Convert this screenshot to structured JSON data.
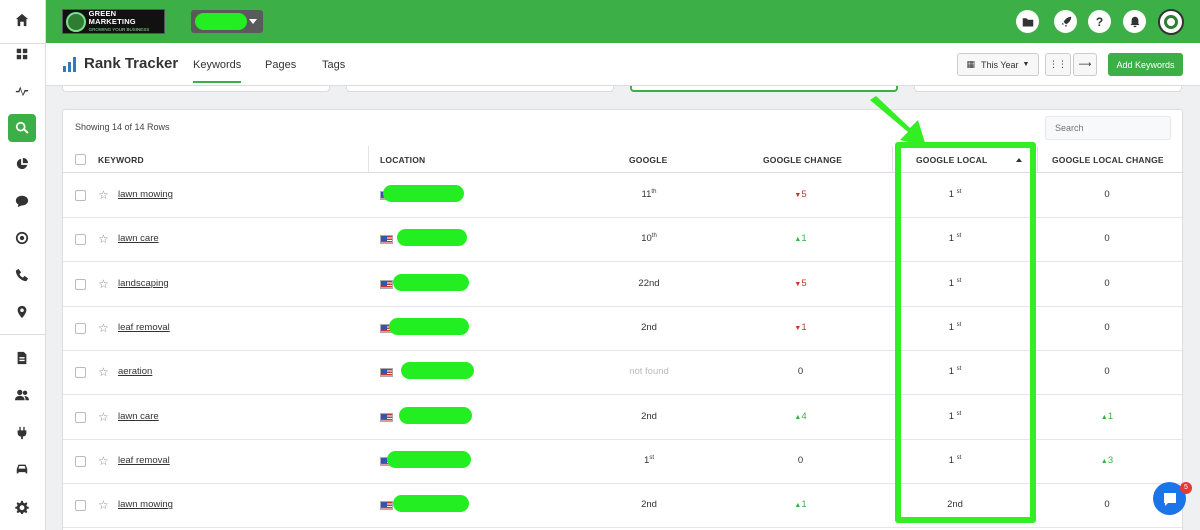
{
  "sidebar": {
    "icons": [
      "home-icon",
      "grid-icon",
      "activity-icon",
      "search-icon",
      "pie-chart-icon",
      "chat-icon",
      "target-icon",
      "phone-icon",
      "map-pin-icon",
      "document-icon",
      "users-icon",
      "plug-icon",
      "car-icon",
      "gear-icon"
    ],
    "active": "search-icon"
  },
  "topbar": {
    "logo_line1": "GREEN MARKETING",
    "logo_line2": "GROWING YOUR BUSINESS",
    "help_label": "?",
    "accent_color": "#3daf47"
  },
  "page": {
    "title": "Rank Tracker",
    "tabs": [
      {
        "label": "Keywords",
        "active": true
      },
      {
        "label": "Pages",
        "active": false
      },
      {
        "label": "Tags",
        "active": false
      }
    ],
    "date_filter": "This Year",
    "add_keywords_label": "Add Keywords"
  },
  "table": {
    "showing": "Showing 14 of 14 Rows",
    "search_placeholder": "Search",
    "headers": {
      "keyword": "KEYWORD",
      "location": "LOCATION",
      "google": "GOOGLE",
      "google_change": "GOOGLE CHANGE",
      "google_local": "GOOGLE LOCAL",
      "google_local_change": "GOOGLE LOCAL CHANGE"
    },
    "rows": [
      {
        "keyword": "lawn mowing",
        "google": "11",
        "google_sup": "th",
        "google_change": "5",
        "google_change_dir": "down",
        "google_local": "1",
        "google_local_sup": "st",
        "local_change": "0",
        "local_change_dir": "none"
      },
      {
        "keyword": "lawn care",
        "google": "10",
        "google_sup": "th",
        "google_change": "1",
        "google_change_dir": "up",
        "google_local": "1",
        "google_local_sup": "st",
        "local_change": "0",
        "local_change_dir": "none"
      },
      {
        "keyword": "landscaping",
        "google": "22nd",
        "google_sup": "",
        "google_change": "5",
        "google_change_dir": "down",
        "google_local": "1",
        "google_local_sup": "st",
        "local_change": "0",
        "local_change_dir": "none"
      },
      {
        "keyword": "leaf removal",
        "google": "2nd",
        "google_sup": "",
        "google_change": "1",
        "google_change_dir": "down",
        "google_local": "1",
        "google_local_sup": "st",
        "local_change": "0",
        "local_change_dir": "none"
      },
      {
        "keyword": "aeration",
        "google": "not found",
        "google_sup": "",
        "google_change": "0",
        "google_change_dir": "none",
        "google_local": "1",
        "google_local_sup": "st",
        "local_change": "0",
        "local_change_dir": "none"
      },
      {
        "keyword": "lawn care",
        "google": "2nd",
        "google_sup": "",
        "google_change": "4",
        "google_change_dir": "up",
        "google_local": "1",
        "google_local_sup": "st",
        "local_change": "1",
        "local_change_dir": "up"
      },
      {
        "keyword": "leaf removal",
        "google": "1",
        "google_sup": "st",
        "google_change": "0",
        "google_change_dir": "none",
        "google_local": "1",
        "google_local_sup": "st",
        "local_change": "3",
        "local_change_dir": "up"
      },
      {
        "keyword": "lawn mowing",
        "google": "2nd",
        "google_sup": "",
        "google_change": "1",
        "google_change_dir": "up",
        "google_local": "2nd",
        "google_local_sup": "",
        "local_change": "0",
        "local_change_dir": "none"
      }
    ]
  },
  "chat": {
    "badge": "5"
  }
}
